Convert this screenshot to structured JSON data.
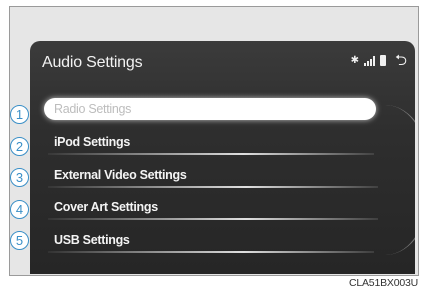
{
  "screen": {
    "title": "Audio Settings"
  },
  "status_icons": [
    "bluetooth-icon",
    "signal-icon",
    "battery-icon",
    "back-icon"
  ],
  "menu": {
    "items": [
      {
        "number": "1",
        "label": "Radio Settings",
        "selected": true
      },
      {
        "number": "2",
        "label": "iPod Settings",
        "selected": false
      },
      {
        "number": "3",
        "label": "External Video Settings",
        "selected": false
      },
      {
        "number": "4",
        "label": "Cover Art Settings",
        "selected": false
      },
      {
        "number": "5",
        "label": "USB Settings",
        "selected": false
      }
    ]
  },
  "figure_code": "CLA51BX003U",
  "colors": {
    "callout": "#3a8fc7",
    "screen_bg": "#2e2e2e",
    "frame_bg": "#e6e6e6"
  }
}
